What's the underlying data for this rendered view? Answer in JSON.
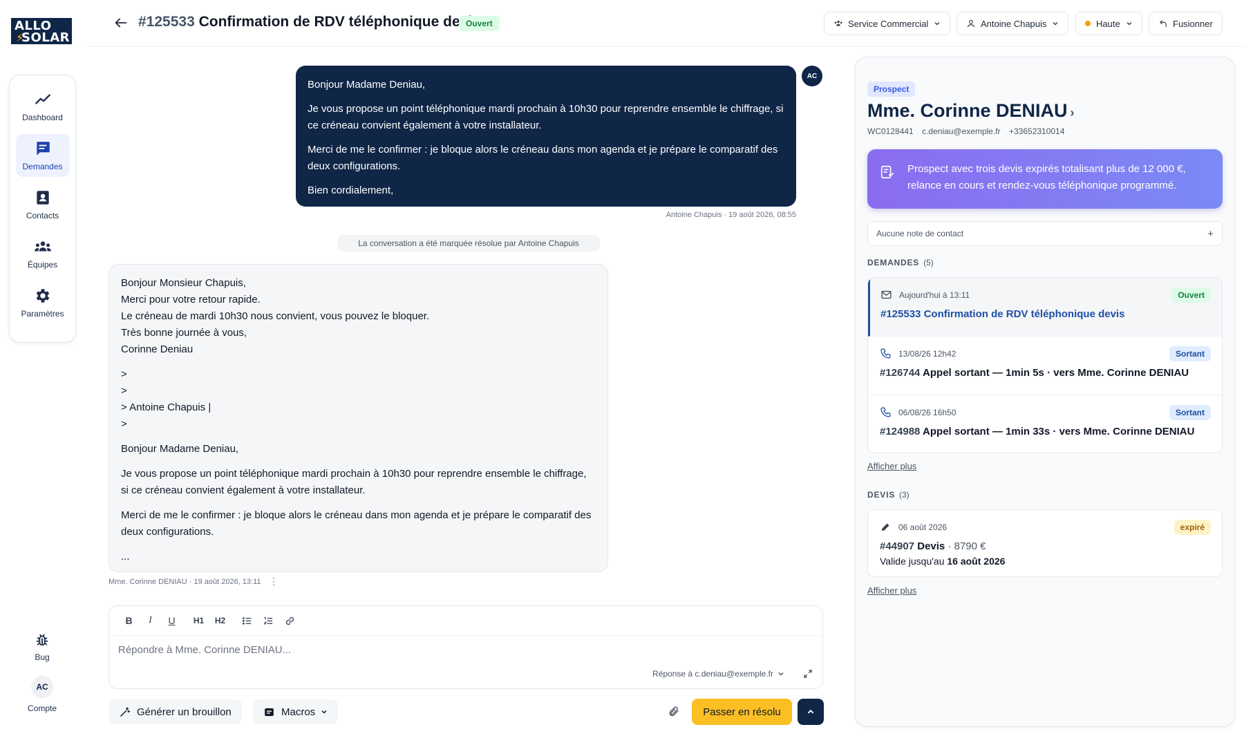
{
  "logo": {
    "line1": "ALLO",
    "line2": "SOLAR"
  },
  "sidebar": {
    "items": [
      {
        "label": "Dashboard",
        "icon": "trend-icon"
      },
      {
        "label": "Demandes",
        "icon": "message-icon"
      },
      {
        "label": "Contacts",
        "icon": "contact-card-icon"
      },
      {
        "label": "Équipes",
        "icon": "team-icon"
      },
      {
        "label": "Paramètres",
        "icon": "gear-icon"
      }
    ],
    "bug_label": "Bug",
    "account_initials": "AC",
    "account_label": "Compte"
  },
  "header": {
    "ticket_number": "#125533",
    "ticket_title": "Confirmation de RDV téléphonique devis",
    "status": "Ouvert",
    "team": "Service Commercial",
    "assignee": "Antoine Chapuis",
    "priority": "Haute",
    "merge_label": "Fusionner"
  },
  "conversation": {
    "outgoing": {
      "avatar": "AC",
      "greeting": "Bonjour Madame Deniau,",
      "p1": "Je vous propose un point téléphonique mardi prochain à 10h30 pour reprendre ensemble le chiffrage, si ce créneau convient également à votre installateur.",
      "p2": "Merci de me le confirmer : je bloque alors le créneau dans mon agenda et je prépare le comparatif des deux configurations.",
      "closing": "Bien cordialement,",
      "meta": "Antoine Chapuis · 19 août 2026, 08:55"
    },
    "system": "La conversation a été marquée résolue par Antoine Chapuis",
    "incoming": {
      "l1": "Bonjour Monsieur Chapuis,",
      "l2": "Merci pour votre retour rapide.",
      "l3": "Le créneau de mardi 10h30 nous convient, vous pouvez le bloquer.",
      "l4": "Très bonne journée à vous,",
      "l5": "Corinne Deniau",
      "q1": ">",
      "q2": ">",
      "q3": "> Antoine Chapuis |",
      "q4": ">",
      "greeting": "Bonjour Madame Deniau,",
      "p1": "Je vous propose un point téléphonique mardi prochain à 10h30 pour reprendre ensemble le chiffrage, si ce créneau convient également à votre installateur.",
      "p2": "Merci de me le confirmer : je bloque alors le créneau dans mon agenda et je prépare le comparatif des deux configurations.",
      "ellipsis": "...",
      "meta": "Mme. Corinne DENIAU · 19 août 2026, 13:11"
    }
  },
  "composer": {
    "toolbar": {
      "bold": "B",
      "italic": "I",
      "underline": "U",
      "h1": "H1",
      "h2": "H2"
    },
    "placeholder": "Répondre à Mme. Corinne DENIAU...",
    "reply_to": "Réponse à c.deniau@exemple.fr",
    "draft_label": "Générer un brouillon",
    "macros_label": "Macros",
    "resolve_label": "Passer en résolu"
  },
  "panel": {
    "tag": "Prospect",
    "name": "Mme. Corinne DENIAU",
    "name_chevron": "›",
    "customer_id": "WC0128441",
    "email": "c.deniau@exemple.fr",
    "phone": "+33652310014",
    "ai_summary": "Prospect avec trois devis expirés totalisant plus de 12 000 €, relance en cours et rendez-vous téléphonique programmé.",
    "note_placeholder": "Aucune note de contact",
    "note_plus": "+",
    "demandes_title": "DEMANDES",
    "demandes_count": "(5)",
    "demandes": [
      {
        "date": "Aujourd'hui à 13:11",
        "badge": "Ouvert",
        "num": "#125533",
        "title": "Confirmation de RDV téléphonique devis",
        "icon": "mail-icon"
      },
      {
        "date": "13/08/26 12h42",
        "badge": "Sortant",
        "num": "#126744",
        "title": "Appel sortant — 1min 5s · vers Mme. Corinne DENIAU",
        "icon": "phone-icon"
      },
      {
        "date": "06/08/26 16h50",
        "badge": "Sortant",
        "num": "#124988",
        "title": "Appel sortant — 1min 33s · vers Mme. Corinne DENIAU",
        "icon": "phone-icon"
      }
    ],
    "more_label": "Afficher plus",
    "devis_title": "DEVIS",
    "devis_count": "(3)",
    "devis": [
      {
        "date": "06 août 2026",
        "badge": "expiré",
        "num": "#44907",
        "title": "Devis",
        "amount": "· 8790 €",
        "valid_prefix": "Valide jusqu'au",
        "valid_date": "16 août 2026"
      }
    ]
  }
}
